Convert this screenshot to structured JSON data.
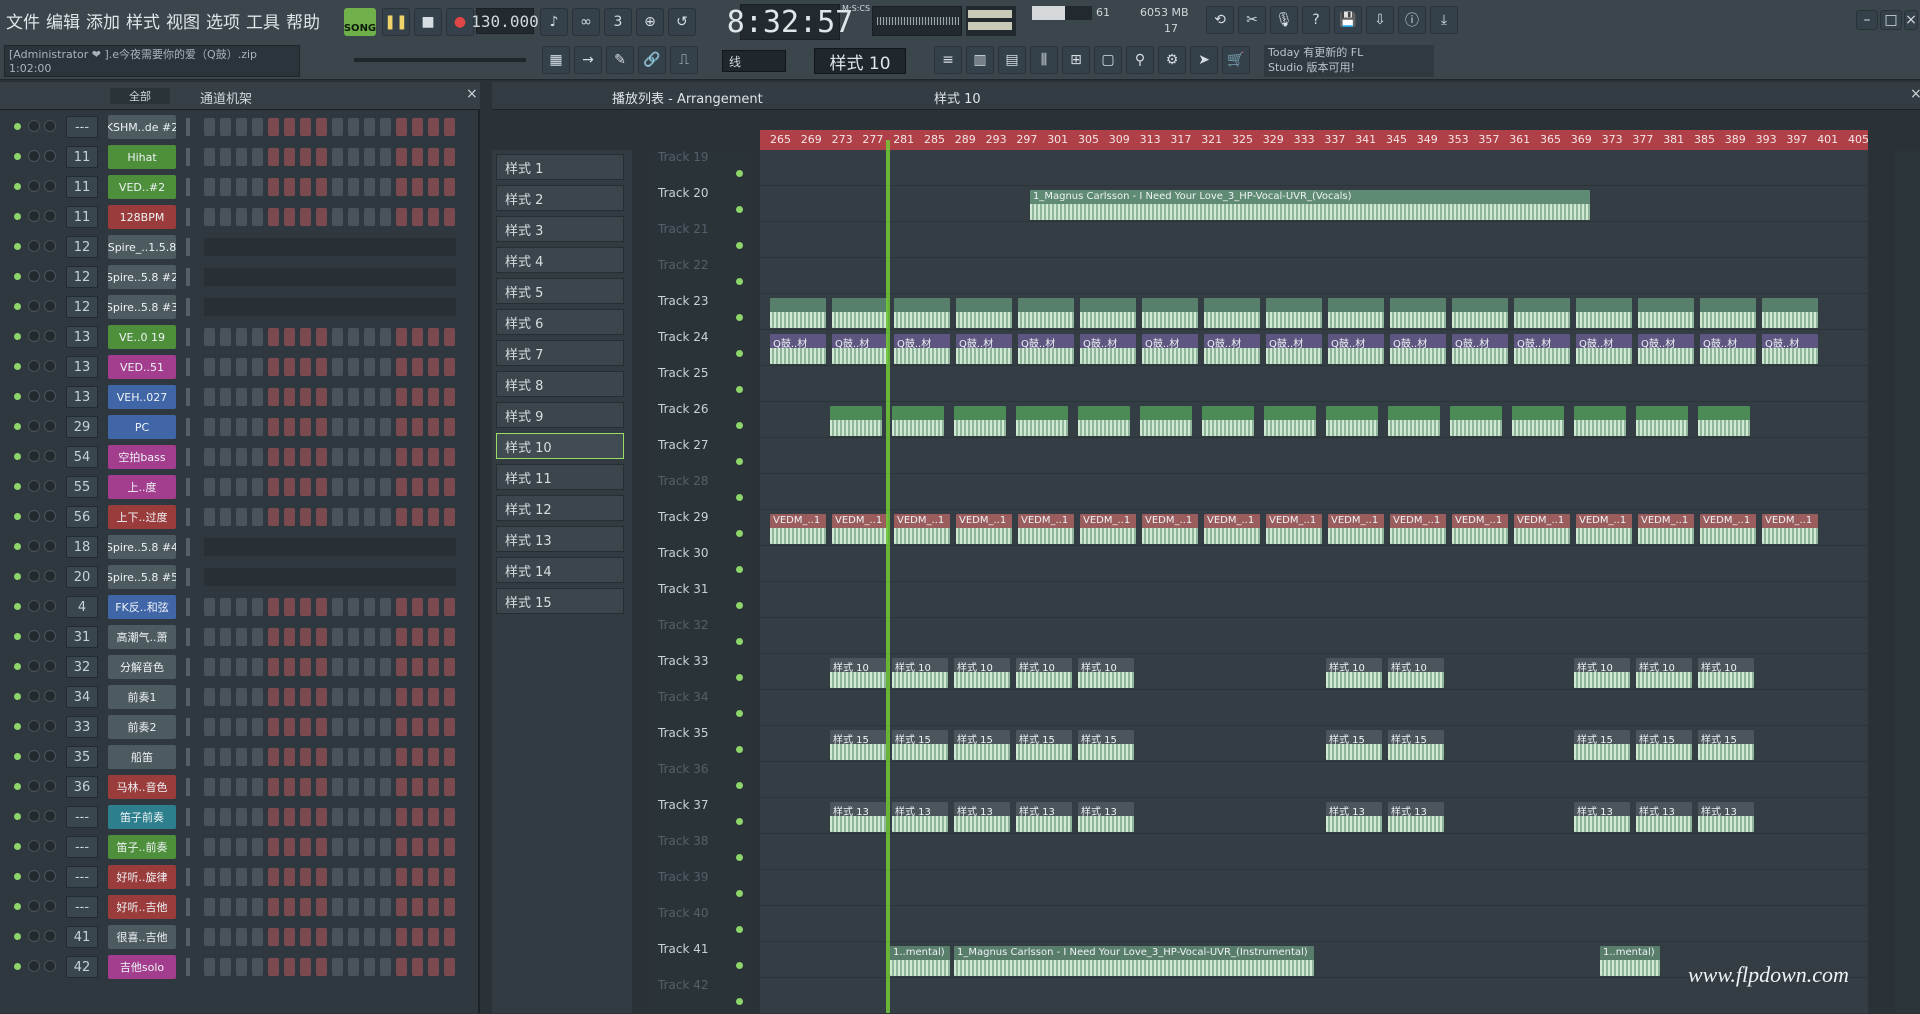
{
  "menu": [
    "文件",
    "编辑",
    "添加",
    "样式",
    "视图",
    "选项",
    "工具",
    "帮助"
  ],
  "transport": {
    "song": "SONG",
    "bpm": "130.000",
    "time": "8:32:57",
    "time_unit": "M:S:CS"
  },
  "meters": {
    "cpu": "61",
    "ram": "6053 MB",
    "poly": "17"
  },
  "info": {
    "user": "[Administrator ❤",
    "file": "].e今夜需要你的爱（Q鼓）.zip",
    "time": "1:02:00"
  },
  "snap": "线",
  "pattern_selector": "样式 10",
  "update_hint": {
    "line1": "Today  有更新的 FL",
    "line2": "Studio 版本可用!"
  },
  "rack": {
    "filter": "全部",
    "title": "通道机架"
  },
  "channels": [
    {
      "num": "---",
      "name": "KSHM..de #2",
      "color": "#4d5a60"
    },
    {
      "num": "11",
      "name": "Hihat",
      "color": "#4e8f3c"
    },
    {
      "num": "11",
      "name": "VED..#2",
      "color": "#4e8f3c"
    },
    {
      "num": "11",
      "name": "128BPM",
      "color": "#9b3c3c"
    },
    {
      "num": "12",
      "name": "Spire_..1.5.8",
      "color": "#4d5a60"
    },
    {
      "num": "12",
      "name": "Spire..5.8 #2",
      "color": "#4d5a60"
    },
    {
      "num": "12",
      "name": "Spire..5.8 #3",
      "color": "#4d5a60"
    },
    {
      "num": "13",
      "name": "VE..0 19",
      "color": "#4e8f3c"
    },
    {
      "num": "13",
      "name": "VED..51",
      "color": "#a33e8e"
    },
    {
      "num": "13",
      "name": "VEH..027",
      "color": "#4066a8"
    },
    {
      "num": "29",
      "name": "PC",
      "color": "#4066a8"
    },
    {
      "num": "54",
      "name": "空拍bass",
      "color": "#a33e8e"
    },
    {
      "num": "55",
      "name": "上..度",
      "color": "#a33e8e"
    },
    {
      "num": "56",
      "name": "上下..过度",
      "color": "#9b3c3c"
    },
    {
      "num": "18",
      "name": "Spire..5.8 #4",
      "color": "#4d5a60"
    },
    {
      "num": "20",
      "name": "Spire..5.8 #5",
      "color": "#4d5a60"
    },
    {
      "num": "4",
      "name": "FK反..和弦",
      "color": "#4066a8"
    },
    {
      "num": "31",
      "name": "高潮气..萧",
      "color": "#4d5a60"
    },
    {
      "num": "32",
      "name": "分解音色",
      "color": "#4d5a60"
    },
    {
      "num": "34",
      "name": "前奏1",
      "color": "#4d5a60"
    },
    {
      "num": "33",
      "name": "前奏2",
      "color": "#4d5a60"
    },
    {
      "num": "35",
      "name": "船笛",
      "color": "#4d5a60"
    },
    {
      "num": "36",
      "name": "马林..音色",
      "color": "#9b3c3c"
    },
    {
      "num": "---",
      "name": "笛子前奏",
      "color": "#2d7f8e"
    },
    {
      "num": "---",
      "name": "笛子..前奏",
      "color": "#4e8f3c"
    },
    {
      "num": "---",
      "name": "好听..旋律",
      "color": "#9b3c3c"
    },
    {
      "num": "---",
      "name": "好听..吉他",
      "color": "#9b3c3c"
    },
    {
      "num": "41",
      "name": "很喜..吉他",
      "color": "#4d5a60"
    },
    {
      "num": "42",
      "name": "吉他solo",
      "color": "#a33e8e"
    }
  ],
  "patterns": [
    "样式 1",
    "样式 2",
    "样式 3",
    "样式 4",
    "样式 5",
    "样式 6",
    "样式 7",
    "样式 8",
    "样式 9",
    "样式 10",
    "样式 11",
    "样式 12",
    "样式 13",
    "样式 14",
    "样式 15"
  ],
  "playlist": {
    "title": "播放列表 - Arrangement",
    "crumb": "样式 10"
  },
  "ruler": [
    "265",
    "269",
    "273",
    "277",
    "281",
    "285",
    "289",
    "293",
    "297",
    "301",
    "305",
    "309",
    "313",
    "317",
    "321",
    "325",
    "329",
    "333",
    "337",
    "341",
    "345",
    "349",
    "353",
    "357",
    "361",
    "365",
    "369",
    "373",
    "377",
    "381",
    "385",
    "389",
    "393",
    "397",
    "401",
    "405"
  ],
  "tracks": [
    "Track 19",
    "Track 20",
    "Track 21",
    "Track 22",
    "Track 23",
    "Track 24",
    "Track 25",
    "Track 26",
    "Track 27",
    "Track 28",
    "Track 29",
    "Track 30",
    "Track 31",
    "Track 32",
    "Track 33",
    "Track 34",
    "Track 35",
    "Track 36",
    "Track 37",
    "Track 38",
    "Track 39",
    "Track 40",
    "Track 41",
    "Track 42"
  ],
  "clips": {
    "vocals": "1_Magnus Carlsson - I Need Your Love_3_HP-Vocal-UVR_(Vocals)",
    "qgu": "Q鼓..材",
    "vedm": "VEDM_..1",
    "p10": "样式 10",
    "p15": "样式 15",
    "p13": "样式 13",
    "mental": "1..mental)",
    "instrumental": "1_Magnus Carlsson - I Need Your Love_3_HP-Vocal-UVR_(Instrumental)"
  },
  "watermark": "www.flpdown.com"
}
